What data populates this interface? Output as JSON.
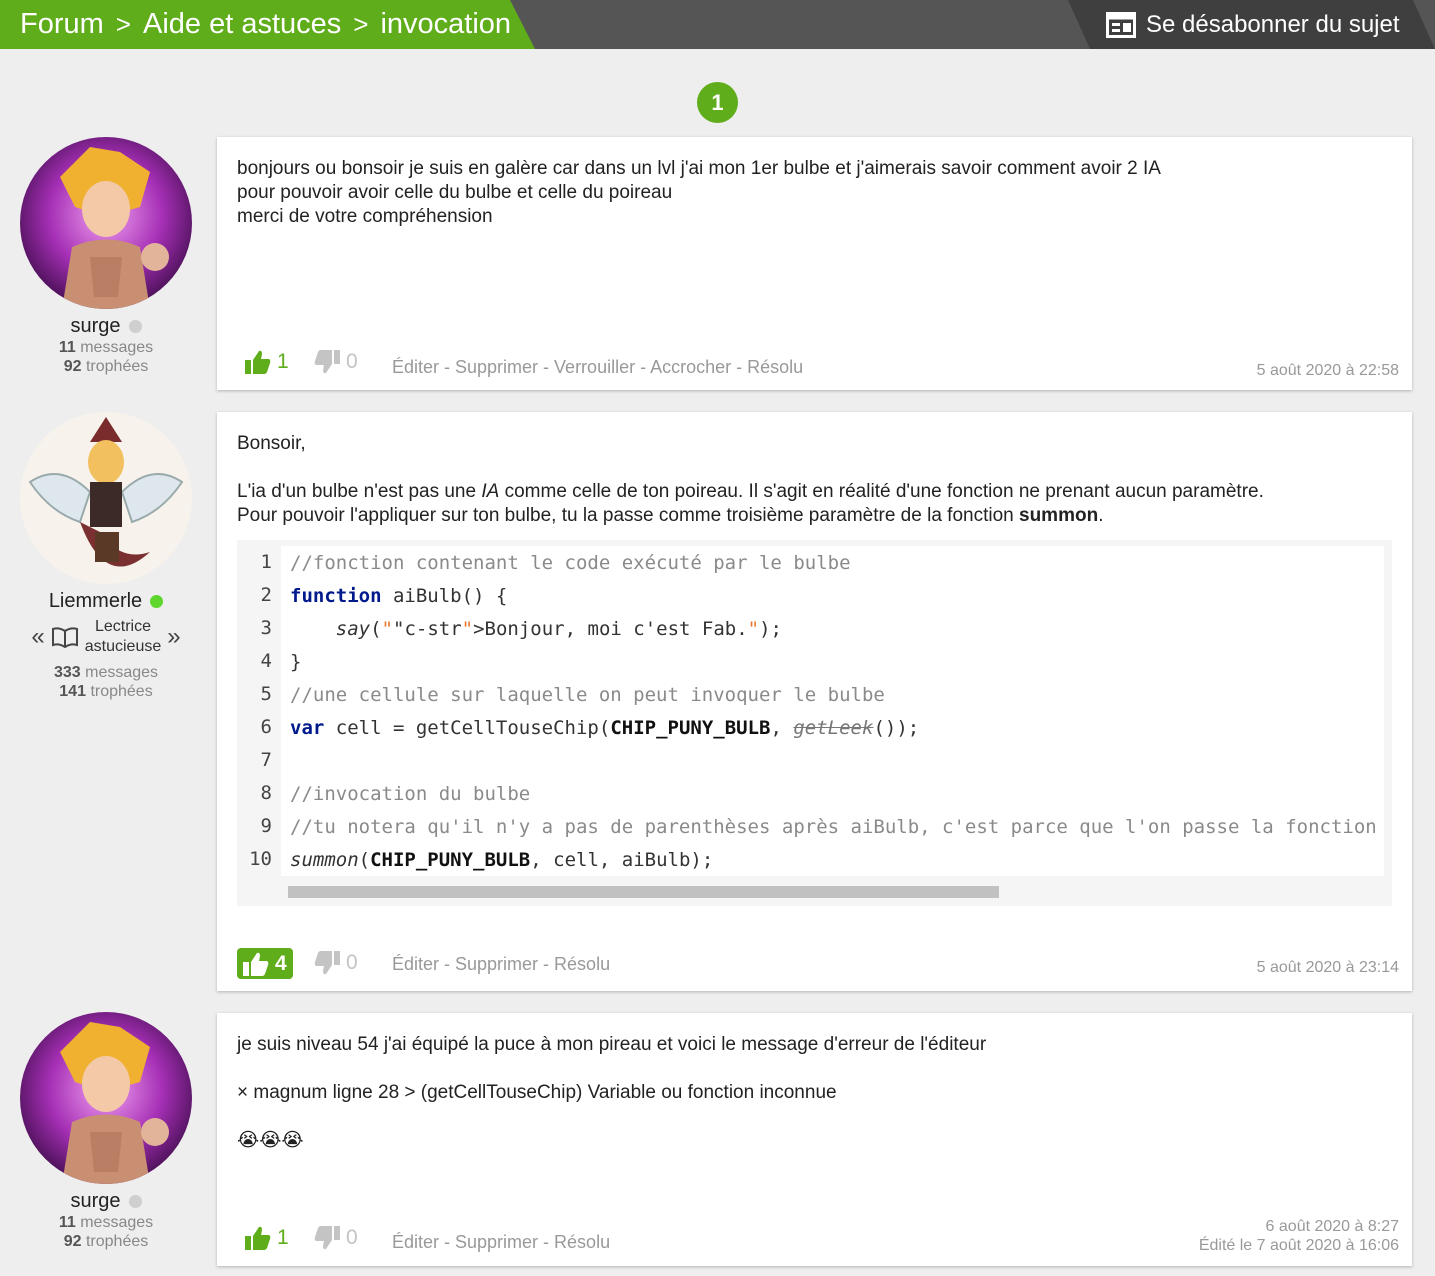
{
  "breadcrumb": [
    "Forum",
    "Aide et astuces",
    "invocation"
  ],
  "breadcrumb_sep": ">",
  "unsubscribe_label": "Se désabonner du sujet",
  "page_number": "1",
  "posts": [
    {
      "author": {
        "name": "surge",
        "online": false,
        "messages": "11",
        "messages_label": "messages",
        "trophies": "92",
        "trophies_label": "trophées"
      },
      "lines": [
        "bonjours ou bonsoir je suis en galère car dans un lvl j'ai mon 1er bulbe et j'aimerais savoir comment avoir 2 IA",
        "pour pouvoir avoir celle du bulbe et celle du poireau",
        "merci de votre compréhension"
      ],
      "votes_up": "1",
      "votes_down": "0",
      "actions": "Éditer - Supprimer - Verrouiller - Accrocher - Résolu",
      "date": "5 août 2020 à 22:58"
    },
    {
      "author": {
        "name": "Liemmerle",
        "online": true,
        "grade_line1": "Lectrice",
        "grade_line2": "astucieuse",
        "grade_left": "«",
        "grade_right": "»",
        "messages": "333",
        "messages_label": "messages",
        "trophies": "141",
        "trophies_label": "trophées"
      },
      "greeting": "Bonsoir,",
      "para_a": "L'ia d'un bulbe n'est pas une ",
      "para_a_em": "IA",
      "para_a_rest": " comme celle de ton poireau. Il s'agit en réalité d'une fonction ne prenant aucun paramètre.",
      "para_b": "Pour pouvoir l'appliquer sur ton bulbe, tu la passe comme troisième paramètre de la fonction ",
      "para_b_strong": "summon",
      "para_b_end": ".",
      "code_lines": [
        "//fonction contenant le code exécuté par le bulbe",
        "function aiBulb() {",
        "    say(\"Bonjour, moi c'est Fab.\");",
        "}",
        "//une cellule sur laquelle on peut invoquer le bulbe",
        "var cell = getCellTouseChip(CHIP_PUNY_BULB, getLeek());",
        "",
        "//invocation du bulbe",
        "//tu notera qu'il n'y a pas de parenthèses après aiBulb, c'est parce que l'on passe la fonction",
        "summon(CHIP_PUNY_BULB, cell, aiBulb);"
      ],
      "votes_up": "4",
      "votes_down": "0",
      "actions": "Éditer - Supprimer - Résolu",
      "date": "5 août 2020 à 23:14"
    },
    {
      "author": {
        "name": "surge",
        "online": false,
        "messages": "11",
        "messages_label": "messages",
        "trophies": "92",
        "trophies_label": "trophées"
      },
      "line1": "je suis niveau 54 j'ai équipé la puce à mon pireau et voici le message d'erreur de l'éditeur",
      "line2": "× magnum ligne 28 > (getCellTouseChip) Variable ou fonction inconnue",
      "emojis": "😭😭😭",
      "votes_up": "1",
      "votes_down": "0",
      "actions": "Éditer - Supprimer - Résolu",
      "date": "6 août 2020 à 8:27",
      "edited": "Édité le 7 août 2020 à 16:06"
    }
  ],
  "colors": {
    "accent": "#5fad1b",
    "header": "#555555",
    "keyword": "#001a8c",
    "string": "#e8772e",
    "comment": "#8a8a8a"
  }
}
